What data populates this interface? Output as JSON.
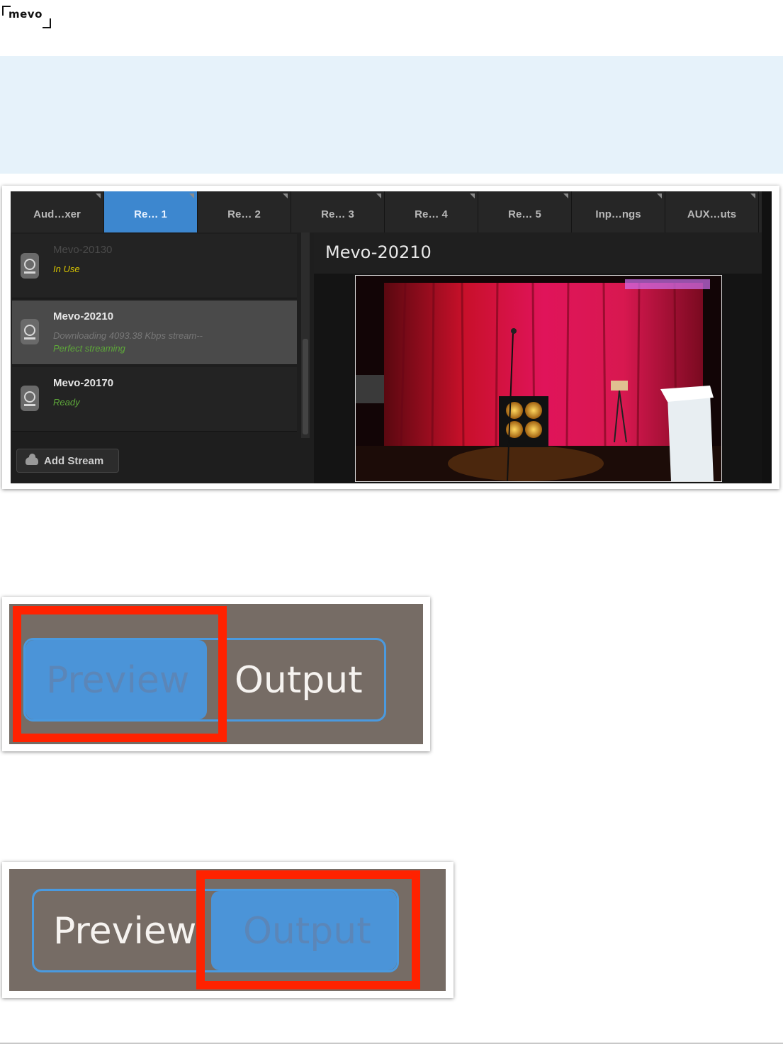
{
  "logo": {
    "text": "mevo"
  },
  "app": {
    "tabs": [
      {
        "label": "Aud…xer",
        "active": false
      },
      {
        "label": "Re… 1",
        "active": true
      },
      {
        "label": "Re… 2",
        "active": false
      },
      {
        "label": "Re… 3",
        "active": false
      },
      {
        "label": "Re… 4",
        "active": false
      },
      {
        "label": "Re… 5",
        "active": false
      },
      {
        "label": "Inp…ngs",
        "active": false
      },
      {
        "label": "AUX…uts",
        "active": false
      }
    ],
    "cameras": [
      {
        "name": "Mevo-20130",
        "status": "In Use",
        "status_color": "#d9c600"
      },
      {
        "name": "Mevo-20210",
        "status": "Downloading 4093.38 Kbps stream--",
        "status2": "Perfect streaming",
        "selected": true
      },
      {
        "name": "Mevo-20170",
        "status": "Ready",
        "status_color": "#5ea83a"
      }
    ],
    "add_stream_label": "Add Stream",
    "preview_title": "Mevo-20210"
  },
  "toggle1": {
    "preview_label": "Preview",
    "output_label": "Output",
    "active": "Preview"
  },
  "toggle2": {
    "preview_label": "Preview",
    "output_label": "Output",
    "active": "Output"
  },
  "colors": {
    "accent_blue": "#3d87cf",
    "highlight_red": "#ff2200",
    "band_blue": "#e6f2fa"
  }
}
